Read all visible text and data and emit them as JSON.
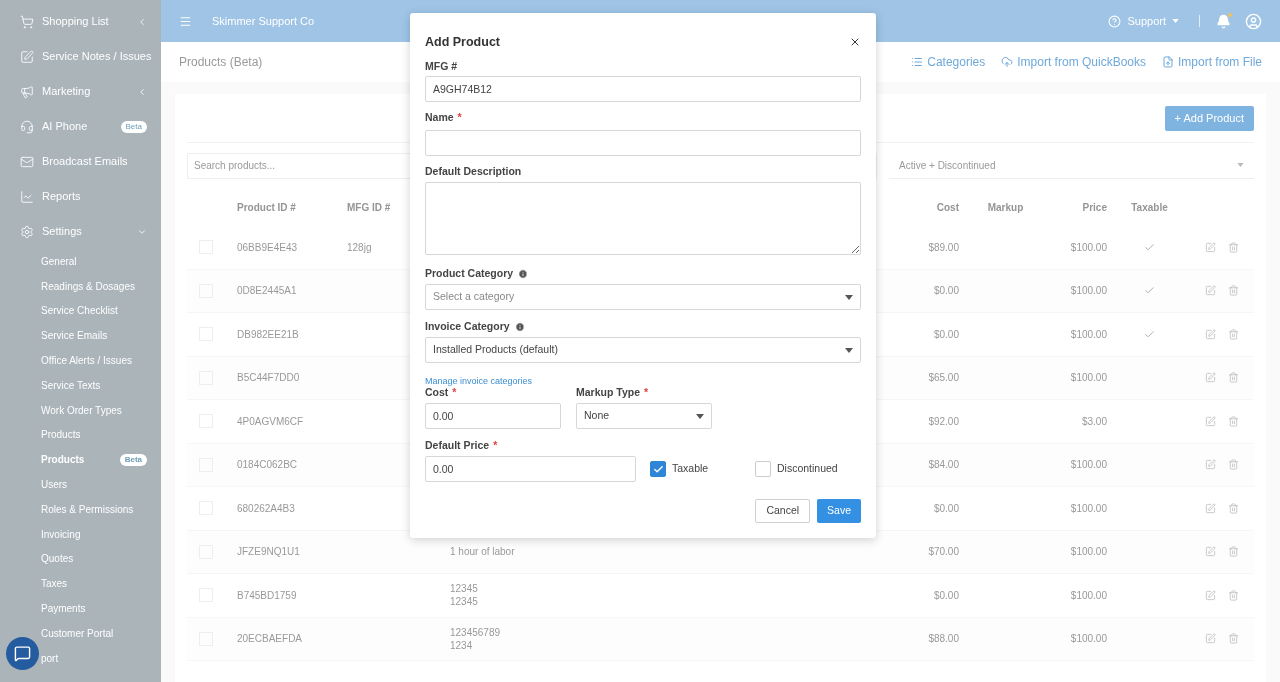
{
  "sidebar": {
    "items": [
      {
        "label": "Shopping List",
        "expanded": false
      },
      {
        "label": "Service Notes / Issues"
      },
      {
        "label": "Marketing",
        "expanded": false
      },
      {
        "label": "AI Phone",
        "badge": "Beta"
      },
      {
        "label": "Broadcast Emails"
      },
      {
        "label": "Reports"
      },
      {
        "label": "Settings",
        "expanded": true,
        "children": [
          {
            "label": "General",
            "selected": false
          },
          {
            "label": "Readings & Dosages",
            "selected": false
          },
          {
            "label": "Service Checklist",
            "selected": false
          },
          {
            "label": "Service Emails",
            "selected": false
          },
          {
            "label": "Office Alerts / Issues",
            "selected": false
          },
          {
            "label": "Service Texts",
            "selected": false
          },
          {
            "label": "Work Order Types",
            "selected": false
          },
          {
            "label": "Products",
            "selected": false
          },
          {
            "label": "Products",
            "badge": "Beta",
            "selected": true
          },
          {
            "label": "Users",
            "selected": false
          },
          {
            "label": "Roles & Permissions",
            "selected": false
          },
          {
            "label": "Invoicing",
            "selected": false
          },
          {
            "label": "Quotes",
            "selected": false
          },
          {
            "label": "Taxes",
            "selected": false
          },
          {
            "label": "Payments",
            "selected": false
          },
          {
            "label": "Customer Portal",
            "selected": false
          },
          {
            "label": "port",
            "selected": false
          }
        ]
      }
    ]
  },
  "topbar": {
    "company": "Skimmer Support Co",
    "support": "Support"
  },
  "page": {
    "title": "Products (Beta)",
    "actions": [
      "Categories",
      "Import from QuickBooks",
      "Import from File"
    ],
    "add_button": "+ Add Product",
    "search": {
      "placeholder": "Search products..."
    },
    "status_filter": "Active + Discontinued"
  },
  "table": {
    "columns": [
      "Product ID #",
      "MFG ID #",
      "Cost",
      "Markup",
      "Price",
      "Taxable"
    ],
    "rows": [
      {
        "checked": false,
        "id": "06BB9E4E43",
        "mfg": "128jg",
        "description": [],
        "cost": "$89.00",
        "price": "$100.00",
        "taxable": true
      },
      {
        "checked": false,
        "id": "0D8E2445A1",
        "description": [],
        "cost": "$0.00",
        "price": "$100.00",
        "taxable": true
      },
      {
        "checked": false,
        "id": "DB982EE21B",
        "description": [],
        "cost": "$0.00",
        "price": "$100.00",
        "taxable": true
      },
      {
        "checked": false,
        "id": "B5C44F7DD0",
        "description": [],
        "cost": "$65.00",
        "price": "$100.00",
        "taxable": false
      },
      {
        "checked": false,
        "id": "4P0AGVM6CF",
        "description": [],
        "cost": "$92.00",
        "price": "$3.00",
        "taxable": false
      },
      {
        "checked": false,
        "id": "0184C062BC",
        "description": [],
        "cost": "$84.00",
        "price": "$100.00",
        "taxable": false
      },
      {
        "checked": false,
        "id": "680262A4B3",
        "description": [],
        "cost": "$0.00",
        "price": "$100.00",
        "taxable": false
      },
      {
        "checked": false,
        "id": "JFZE9NQ1U1",
        "description": [
          "1 hour of labor"
        ],
        "cost": "$70.00",
        "price": "$100.00",
        "taxable": false
      },
      {
        "checked": false,
        "id": "B745BD1759",
        "description": [
          "12345",
          "12345"
        ],
        "cost": "$0.00",
        "price": "$100.00",
        "taxable": false
      },
      {
        "checked": false,
        "id": "20ECBAEFDA",
        "description": [
          "123456789",
          "1234"
        ],
        "cost": "$88.00",
        "price": "$100.00",
        "taxable": false
      }
    ]
  },
  "dialog": {
    "title": "Add Product",
    "mfg": {
      "label": "MFG #",
      "value": "A9GH74B12"
    },
    "name": {
      "label": "Name",
      "required_mark": "*"
    },
    "description": {
      "label": "Default Description"
    },
    "product_category": {
      "label": "Product Category",
      "placeholder": "Select a category"
    },
    "invoice_category": {
      "label": "Invoice Category",
      "value": "Installed Products (default)"
    },
    "manage_link": "Manage invoice categories",
    "cost": {
      "label": "Cost",
      "required_mark": "*",
      "value": "0.00"
    },
    "markup_type": {
      "label": "Markup Type",
      "required_mark": "*",
      "value": "None"
    },
    "default_price": {
      "label": "Default Price",
      "required_mark": "*",
      "value": "0.00"
    },
    "taxable": {
      "label": "Taxable",
      "checked": true
    },
    "discontinued": {
      "label": "Discontinued",
      "checked": false
    },
    "buttons": [
      "Cancel",
      "Save"
    ]
  }
}
